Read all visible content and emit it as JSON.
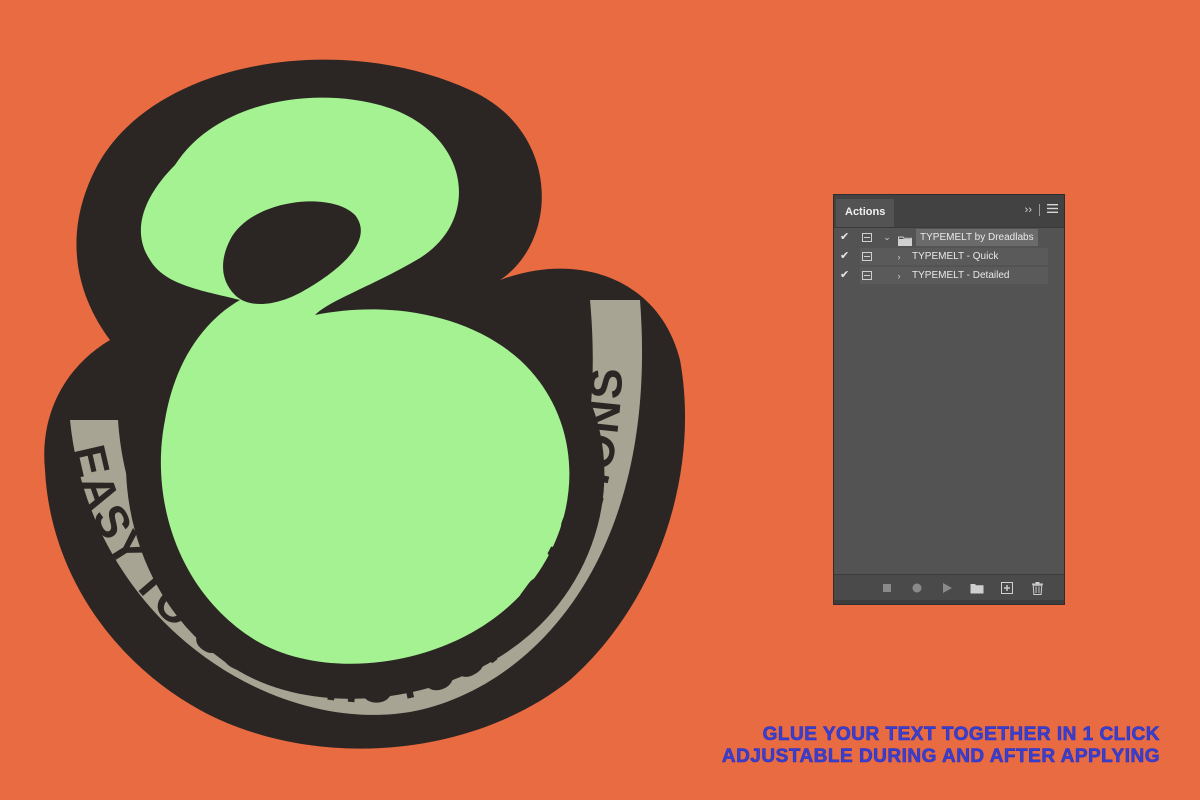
{
  "colors": {
    "background": "#e96b41",
    "sticker_outline": "#2b2624",
    "sticker_fill": "#a4f292",
    "sticker_ring": "#a8a493",
    "panel_bg": "#535353",
    "tagline": "#3a3fd0"
  },
  "sticker": {
    "arc_text": "EASY TO USE PHOTOSHOP ACTIONS"
  },
  "panel": {
    "tab_label": "Actions",
    "controls": {
      "expand_icon": "double-chevron-right-icon",
      "menu_icon": "hamburger-menu-icon"
    },
    "rows": [
      {
        "label": "TYPEMELT by Dreadlabs",
        "type": "set",
        "checked": true,
        "icon": "folder-icon"
      },
      {
        "label": "TYPEMELT - Quick",
        "type": "action",
        "checked": true
      },
      {
        "label": "TYPEMELT - Detailed",
        "type": "action",
        "checked": true
      }
    ],
    "footer_icons": [
      "stop-icon",
      "record-icon",
      "play-icon",
      "folder-icon",
      "new-action-icon",
      "trash-icon"
    ]
  },
  "tagline": {
    "line1": "GLUE YOUR TEXT TOGETHER IN 1 CLICK",
    "line2": "ADJUSTABLE  DURING AND AFTER APPLYING"
  }
}
